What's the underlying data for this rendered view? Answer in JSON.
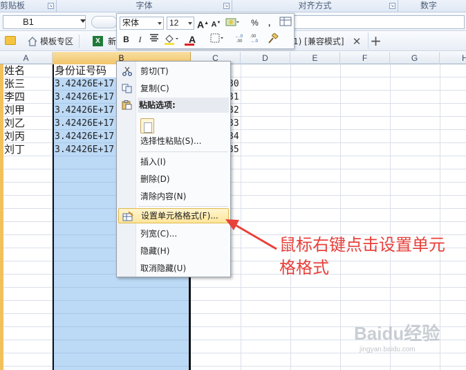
{
  "ribbon": {
    "groups": [
      {
        "label": "剪贴板"
      },
      {
        "label": "字体"
      },
      {
        "label": "对齐方式"
      },
      {
        "label": "数字"
      }
    ]
  },
  "formula_bar": {
    "name_box": "B1",
    "formula": ""
  },
  "tabs": {
    "templates_label": "模板专区",
    "book_label": "新",
    "doc_title_fragment": "1)  [兼容模式]",
    "close_glyph": "✕",
    "add_glyph": "+"
  },
  "mini_toolbar": {
    "font": "宋体",
    "size": "12",
    "bold": "B",
    "italic": "I",
    "grow": "A",
    "shrink": "A",
    "percent": "%",
    "comma": ",",
    "font_color_letter": "A",
    "accent_red": "#e02020",
    "accent_yellow": "#f5e23a"
  },
  "sheet": {
    "columns": [
      "A",
      "B",
      "C",
      "D",
      "E",
      "F",
      "G",
      "H"
    ],
    "selected_column": "B",
    "rows": [
      {
        "a": "姓名",
        "b": "身份证号码",
        "c": ""
      },
      {
        "a": "张三",
        "b": "3.42426E+17",
        "c": "30"
      },
      {
        "a": "李四",
        "b": "3.42426E+17",
        "c": "31"
      },
      {
        "a": "刘甲",
        "b": "3.42426E+17",
        "c": "32"
      },
      {
        "a": "刘乙",
        "b": "3.42426E+17",
        "c": "33"
      },
      {
        "a": "刘丙",
        "b": "3.42426E+17",
        "c": "34"
      },
      {
        "a": "刘丁",
        "b": "3.42426E+17",
        "c": "35"
      }
    ],
    "selection_color": "#bcd9f5",
    "header_selected_color": "#f1c46a"
  },
  "context_menu": {
    "cut": "剪切(T)",
    "copy": "复制(C)",
    "paste_options": "粘贴选项:",
    "paste_special": "选择性粘贴(S)...",
    "insert": "插入(I)",
    "delete": "删除(D)",
    "clear": "清除内容(N)",
    "format_cells": "设置单元格格式(F)...",
    "column_width": "列宽(C)...",
    "hide": "隐藏(H)",
    "unhide": "取消隐藏(U)"
  },
  "annotation": {
    "text": "鼠标右键点击设置单元格格式",
    "color": "#e8403a"
  },
  "watermark": {
    "text": "Baidu经验",
    "sub": "jingyan.baidu.com"
  }
}
